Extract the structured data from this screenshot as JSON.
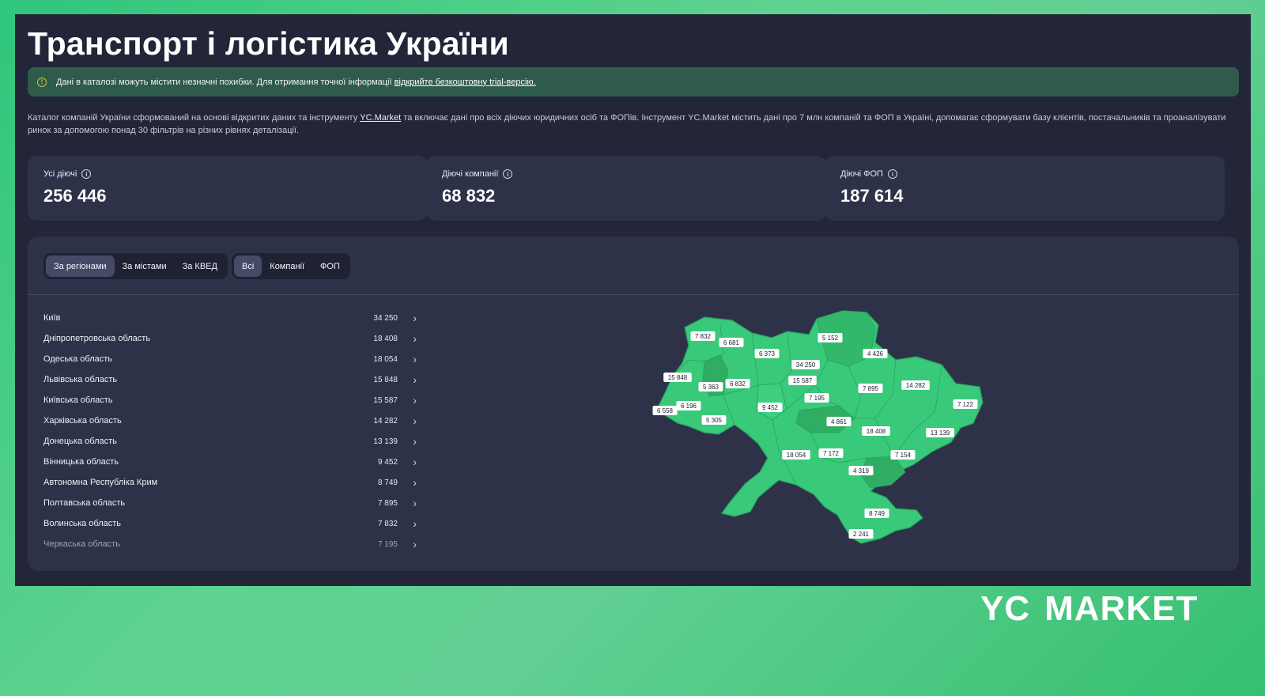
{
  "page": {
    "title": "Транспорт і логістика України",
    "notice": {
      "text": "Дані в каталозі можуть містити незначні похибки. Для отримання точної інформації",
      "link": "відкрийте безкоштовну trial-версію."
    },
    "description": {
      "before": "Каталог компаній України сформований на основі відкритих даних та інструменту",
      "link": "YC.Market",
      "after": "та включає дані про всіх діючих юридичних осіб та ФОПів. Інструмент YC.Market містить дані про 7 млн компаній та ФОП в Україні, допомагає сформувати базу клієнтів, постачальників та проаналізувати ринок за допомогою понад 30 фільтрів на різних рівнях деталізації."
    }
  },
  "stats": [
    {
      "label": "Усі діючі",
      "value": "256 446"
    },
    {
      "label": "Діючі компанії",
      "value": "68 832"
    },
    {
      "label": "Діючі ФОП",
      "value": "187 614"
    }
  ],
  "tabs_group": {
    "items": [
      "За регіонами",
      "За містами",
      "За КВЕД"
    ],
    "active": "За регіонами"
  },
  "filter_group": {
    "items": [
      "Всі",
      "Компанії",
      "ФОП"
    ],
    "active": "Всі"
  },
  "regions": [
    {
      "name": "Київ",
      "value": "34 250"
    },
    {
      "name": "Дніпропетровська область",
      "value": "18 408"
    },
    {
      "name": "Одеська область",
      "value": "18 054"
    },
    {
      "name": "Львівська область",
      "value": "15 848"
    },
    {
      "name": "Київська область",
      "value": "15 587"
    },
    {
      "name": "Харківська область",
      "value": "14 282"
    },
    {
      "name": "Донецька область",
      "value": "13 139"
    },
    {
      "name": "Вінницька область",
      "value": "9 452"
    },
    {
      "name": "Автономна Республіка Крим",
      "value": "8 749"
    },
    {
      "name": "Полтавська область",
      "value": "7 895"
    },
    {
      "name": "Волинська область",
      "value": "7 832"
    },
    {
      "name": "Черкаська область",
      "value": "7 195"
    }
  ],
  "map_labels": [
    "7 832",
    "6 681",
    "6 373",
    "5 152",
    "4 426",
    "34 250",
    "15 587",
    "15 848",
    "5 363",
    "6 832",
    "9 452",
    "7 195",
    "7 895",
    "14 282",
    "7 122",
    "6 558",
    "6 196",
    "5 305",
    "4 861",
    "18 408",
    "13 139",
    "18 054",
    "7 172",
    "7 154",
    "4 319",
    "8 749",
    "2 241"
  ],
  "colors": {
    "map_fill": "#38c97a",
    "map_dark": "#2fae63",
    "accent": "#2f5b4b"
  },
  "logo": {
    "text": "MARKET",
    "mark": "YC"
  }
}
